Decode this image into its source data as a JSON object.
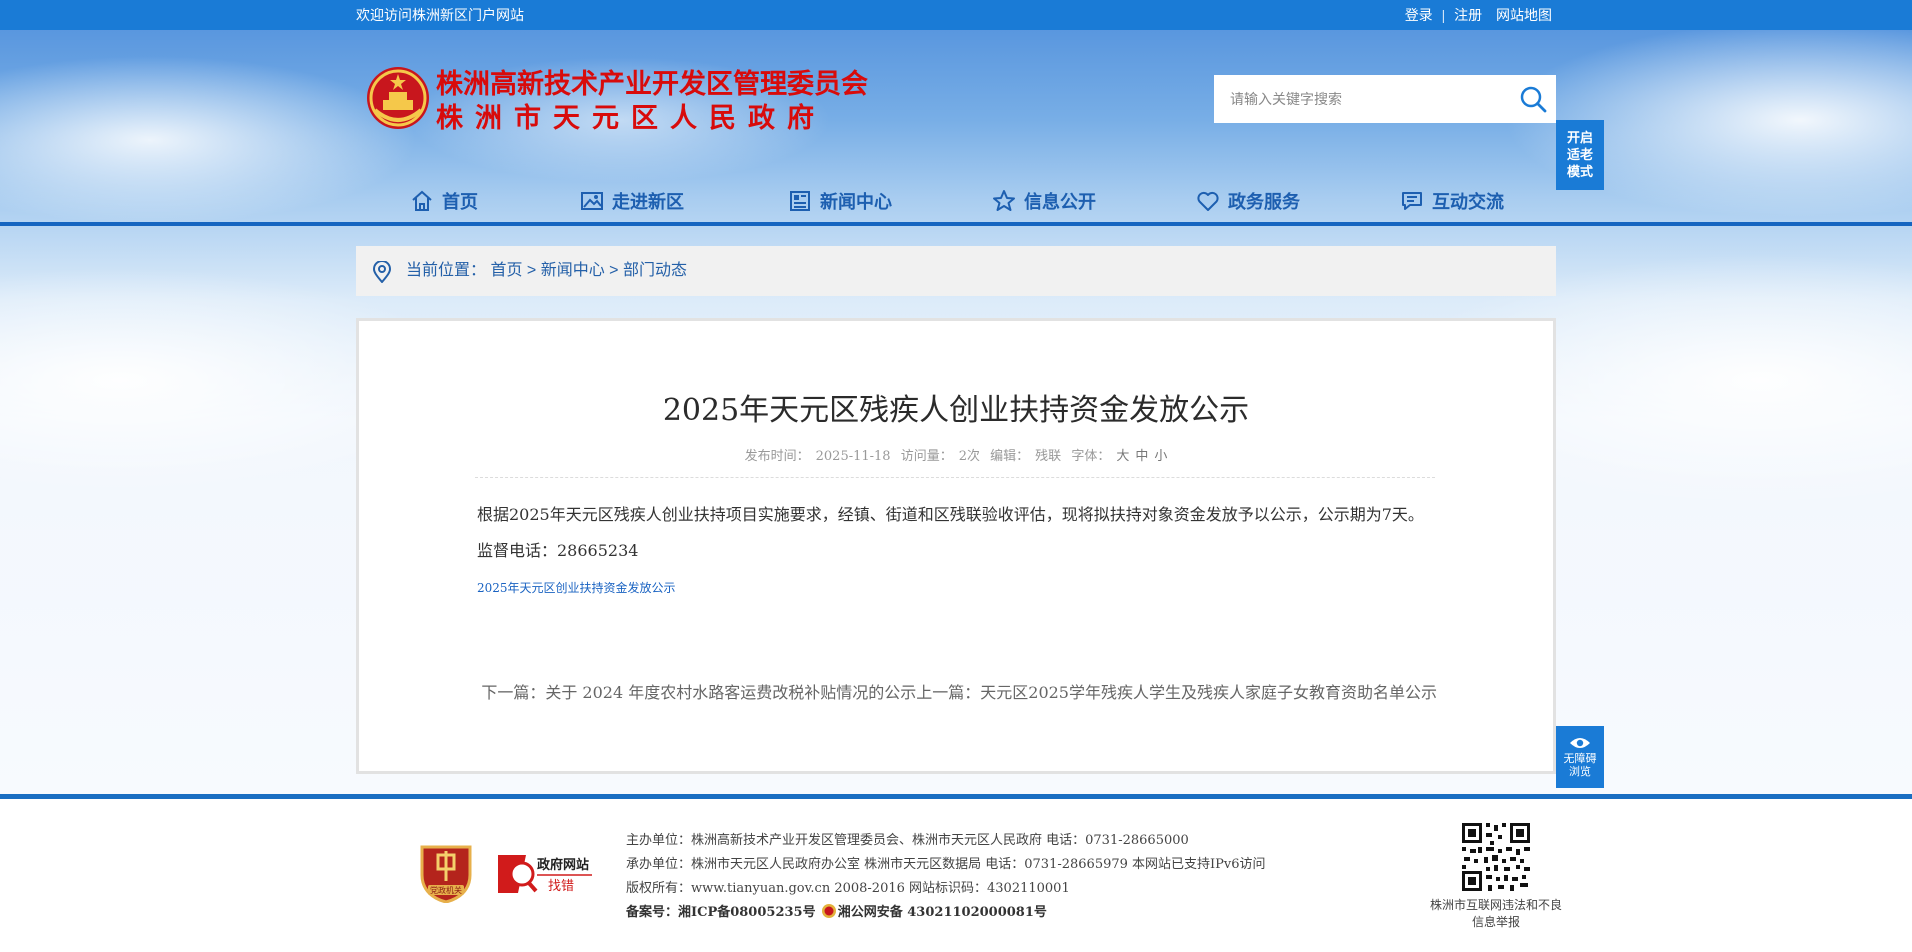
{
  "topbar": {
    "welcome": "欢迎访问株洲新区门户网站",
    "login": "登录",
    "sep": "|",
    "register": "注册",
    "sitemap": "网站地图"
  },
  "header": {
    "title_line1": "株洲高新技术产业开发区管理委员会",
    "title_line2": "株洲市天元区人民政府",
    "search_placeholder": "请输入关键字搜索",
    "elder_mode": "开启适老模式"
  },
  "nav": {
    "items": [
      {
        "label": "首页",
        "icon": "home-icon"
      },
      {
        "label": "走进新区",
        "icon": "picture-icon"
      },
      {
        "label": "新闻中心",
        "icon": "newspaper-icon"
      },
      {
        "label": "信息公开",
        "icon": "star-icon"
      },
      {
        "label": "政务服务",
        "icon": "heart-icon"
      },
      {
        "label": "互动交流",
        "icon": "chat-icon"
      }
    ]
  },
  "breadcrumb": {
    "label": "当前位置：",
    "home": "首页",
    "sep": " > ",
    "section": "新闻中心",
    "current": "部门动态"
  },
  "article": {
    "title": "2025年天元区残疾人创业扶持资金发放公示",
    "meta": {
      "date_label": "发布时间：",
      "date": "2025-11-18",
      "views_label": "访问量：",
      "views": "2次",
      "editor_label": "编辑：",
      "editor": "残联",
      "font_label": "字体：",
      "font_large": "大",
      "font_medium": "中",
      "font_small": "小"
    },
    "body": "根据2025年天元区残疾人创业扶持项目实施要求，经镇、街道和区残联验收评估，现将拟扶持对象资金发放予以公示，公示期为7天。监督电话：28665234",
    "attachment": "2025年天元区创业扶持资金发放公示",
    "next_label": "下一篇：",
    "next_title": "关于 2024 年度农村水路客运费改税补贴情况的公示",
    "prev_label": "上一篇：",
    "prev_title": "天元区2025学年残疾人学生及残疾人家庭子女教育资助名单公示"
  },
  "accessibility": {
    "label": "无障碍浏览"
  },
  "footer": {
    "host": "主办单位：株洲高新技术产业开发区管理委员会、株洲市天元区人民政府 电话：0731-28665000",
    "organizer": "承办单位：株洲市天元区人民政府办公室 株洲市天元区数据局 电话：0731-28665979 本网站已支持IPv6访问",
    "copyright": "版权所有：www.tianyuan.gov.cn 2008-2016 网站标识码：4302110001",
    "icp_label": "备案号：",
    "icp": "湘ICP备08005235号",
    "police": "湘公网安备 43021102000081号",
    "badge_party": "党政机关",
    "badge_gov": "政府网站",
    "badge_gov_sub": "找错",
    "report": "株洲市互联网违法和不良信息举报"
  },
  "colors": {
    "brand_blue": "#1a7bd6",
    "title_red": "#d80b0b",
    "nav_text": "#1d5fb0"
  }
}
